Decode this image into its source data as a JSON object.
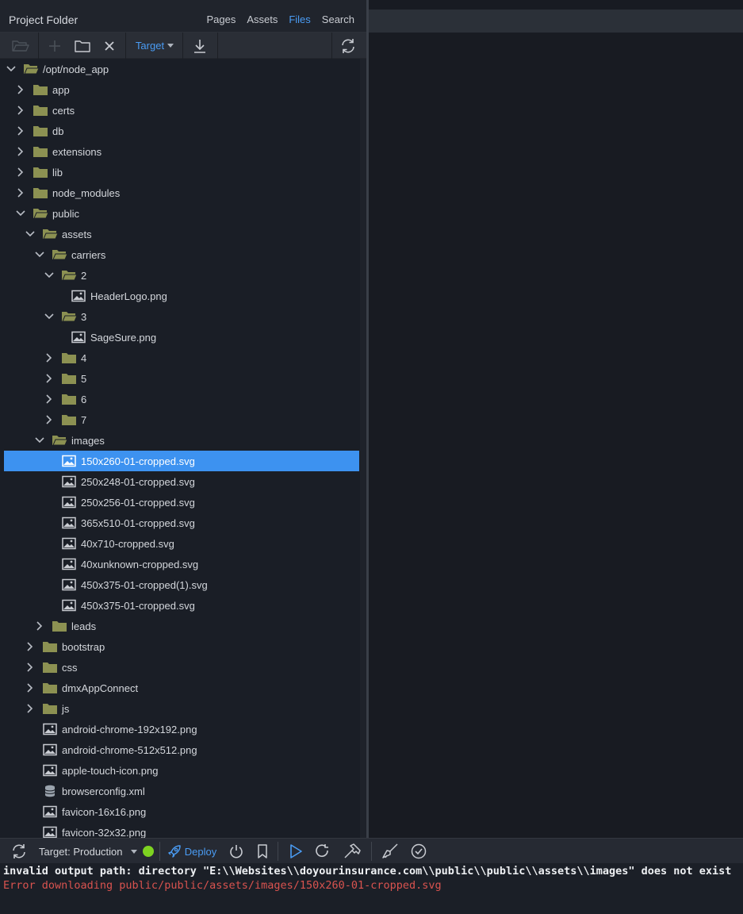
{
  "header": {
    "title": "Project Folder",
    "tabs": [
      {
        "label": "Pages",
        "active": false
      },
      {
        "label": "Assets",
        "active": false
      },
      {
        "label": "Files",
        "active": true
      },
      {
        "label": "Search",
        "active": false
      }
    ]
  },
  "toolbar": {
    "target_label": "Target"
  },
  "tree": [
    {
      "label": "/opt/node_app",
      "depth": 0,
      "type": "folder",
      "expanded": true
    },
    {
      "label": "app",
      "depth": 1,
      "type": "folder",
      "expanded": false
    },
    {
      "label": "certs",
      "depth": 1,
      "type": "folder",
      "expanded": false
    },
    {
      "label": "db",
      "depth": 1,
      "type": "folder",
      "expanded": false
    },
    {
      "label": "extensions",
      "depth": 1,
      "type": "folder",
      "expanded": false
    },
    {
      "label": "lib",
      "depth": 1,
      "type": "folder",
      "expanded": false
    },
    {
      "label": "node_modules",
      "depth": 1,
      "type": "folder",
      "expanded": false
    },
    {
      "label": "public",
      "depth": 1,
      "type": "folder",
      "expanded": true
    },
    {
      "label": "assets",
      "depth": 2,
      "type": "folder",
      "expanded": true
    },
    {
      "label": "carriers",
      "depth": 3,
      "type": "folder",
      "expanded": true
    },
    {
      "label": "2",
      "depth": 4,
      "type": "folder",
      "expanded": true
    },
    {
      "label": "HeaderLogo.png",
      "depth": 5,
      "type": "image"
    },
    {
      "label": "3",
      "depth": 4,
      "type": "folder",
      "expanded": true
    },
    {
      "label": "SageSure.png",
      "depth": 5,
      "type": "image"
    },
    {
      "label": "4",
      "depth": 4,
      "type": "folder",
      "expanded": false
    },
    {
      "label": "5",
      "depth": 4,
      "type": "folder",
      "expanded": false
    },
    {
      "label": "6",
      "depth": 4,
      "type": "folder",
      "expanded": false
    },
    {
      "label": "7",
      "depth": 4,
      "type": "folder",
      "expanded": false
    },
    {
      "label": "images",
      "depth": 3,
      "type": "folder",
      "expanded": true
    },
    {
      "label": "150x260-01-cropped.svg",
      "depth": 4,
      "type": "image",
      "selected": true
    },
    {
      "label": "250x248-01-cropped.svg",
      "depth": 4,
      "type": "image"
    },
    {
      "label": "250x256-01-cropped.svg",
      "depth": 4,
      "type": "image"
    },
    {
      "label": "365x510-01-cropped.svg",
      "depth": 4,
      "type": "image"
    },
    {
      "label": "40x710-cropped.svg",
      "depth": 4,
      "type": "image"
    },
    {
      "label": "40xunknown-cropped.svg",
      "depth": 4,
      "type": "image"
    },
    {
      "label": "450x375-01-cropped(1).svg",
      "depth": 4,
      "type": "image"
    },
    {
      "label": "450x375-01-cropped.svg",
      "depth": 4,
      "type": "image"
    },
    {
      "label": "leads",
      "depth": 3,
      "type": "folder",
      "expanded": false
    },
    {
      "label": "bootstrap",
      "depth": 2,
      "type": "folder",
      "expanded": false
    },
    {
      "label": "css",
      "depth": 2,
      "type": "folder",
      "expanded": false
    },
    {
      "label": "dmxAppConnect",
      "depth": 2,
      "type": "folder",
      "expanded": false
    },
    {
      "label": "js",
      "depth": 2,
      "type": "folder",
      "expanded": false
    },
    {
      "label": "android-chrome-192x192.png",
      "depth": 2,
      "type": "image"
    },
    {
      "label": "android-chrome-512x512.png",
      "depth": 2,
      "type": "image"
    },
    {
      "label": "apple-touch-icon.png",
      "depth": 2,
      "type": "image"
    },
    {
      "label": "browserconfig.xml",
      "depth": 2,
      "type": "database"
    },
    {
      "label": "favicon-16x16.png",
      "depth": 2,
      "type": "image"
    },
    {
      "label": "favicon-32x32.png",
      "depth": 2,
      "type": "image"
    }
  ],
  "bottom_bar": {
    "target_text": "Target: Production",
    "status_color": "#7ed321",
    "deploy_label": "Deploy"
  },
  "console": {
    "lines": [
      {
        "text": "invalid output path: directory \"E:\\\\Websites\\\\doyourinsurance.com\\\\public\\\\public\\\\assets\\\\images\" does not exist",
        "kind": "info"
      },
      {
        "text": "Error downloading public/public/assets/images/150x260-01-cropped.svg",
        "kind": "error"
      }
    ]
  },
  "colors": {
    "accent": "#4a9cf4",
    "selection": "#3d92f0",
    "folder": "#8c9152",
    "error": "#d9534f"
  }
}
